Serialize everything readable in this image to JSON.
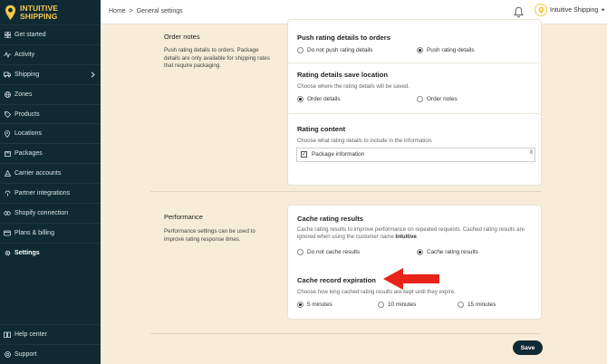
{
  "brand": {
    "line1": "INTUITIVE",
    "line2": "SHIPPING",
    "color": "#f7c948"
  },
  "sidebar": {
    "items": [
      {
        "label": "Get started",
        "icon": "grid-icon"
      },
      {
        "label": "Activity",
        "icon": "pulse-icon"
      },
      {
        "label": "Shipping",
        "icon": "truck-icon"
      },
      {
        "label": "Zones",
        "icon": "globe-icon"
      },
      {
        "label": "Products",
        "icon": "tag-icon"
      },
      {
        "label": "Locations",
        "icon": "pin-icon"
      },
      {
        "label": "Packages",
        "icon": "box-icon"
      },
      {
        "label": "Carrier accounts",
        "icon": "carrier-icon"
      },
      {
        "label": "Partner integrations",
        "icon": "plug-icon"
      },
      {
        "label": "Shopify connection",
        "icon": "link-icon"
      },
      {
        "label": "Plans & billing",
        "icon": "card-icon"
      },
      {
        "label": "Settings",
        "icon": "gear-icon"
      }
    ],
    "bottom": [
      {
        "label": "Help center",
        "icon": "book-icon"
      },
      {
        "label": "Support",
        "icon": "help-icon"
      }
    ]
  },
  "header": {
    "breadcrumb_home": "Home",
    "breadcrumb_sep": ">",
    "breadcrumb_current": "General settings",
    "account_name": "Intuitive Shipping"
  },
  "order_notes": {
    "title": "Order notes",
    "description": "Push rating details to orders. Package details are only available for shipping rates that require packaging.",
    "push": {
      "title": "Push rating details to orders",
      "options": [
        "Do not push rating details",
        "Push rating details"
      ],
      "selected": "Push rating details"
    },
    "location": {
      "title": "Rating details save location",
      "description": "Choose where the rating details will be saved.",
      "options": [
        "Order details",
        "Order notes"
      ],
      "selected": "Order details"
    },
    "content": {
      "title": "Rating content",
      "description": "Choose what rating details to include in the information.",
      "items": [
        {
          "label": "Package information",
          "checked": true
        }
      ]
    }
  },
  "performance": {
    "title": "Performance",
    "description": "Performance settings can be used to improve rating response times.",
    "cache": {
      "title": "Cache rating results",
      "description_prefix": "Cache rating results to improve performance on repeated requests. Cached rating results are ignored when using the customer name ",
      "description_bold": "Intuitive",
      "description_suffix": ".",
      "options": [
        "Do not cache results",
        "Cache rating results"
      ],
      "selected": "Cache rating results"
    },
    "expiration": {
      "title": "Cache record expiration",
      "description": "Choose how long cached rating results are kept until they expire.",
      "options": [
        "5 minutes",
        "10 minutes",
        "15 minutes"
      ],
      "selected": "5 minutes"
    }
  },
  "actions": {
    "save_label": "Save"
  },
  "annotation": {
    "arrow_color": "#e8231a"
  }
}
